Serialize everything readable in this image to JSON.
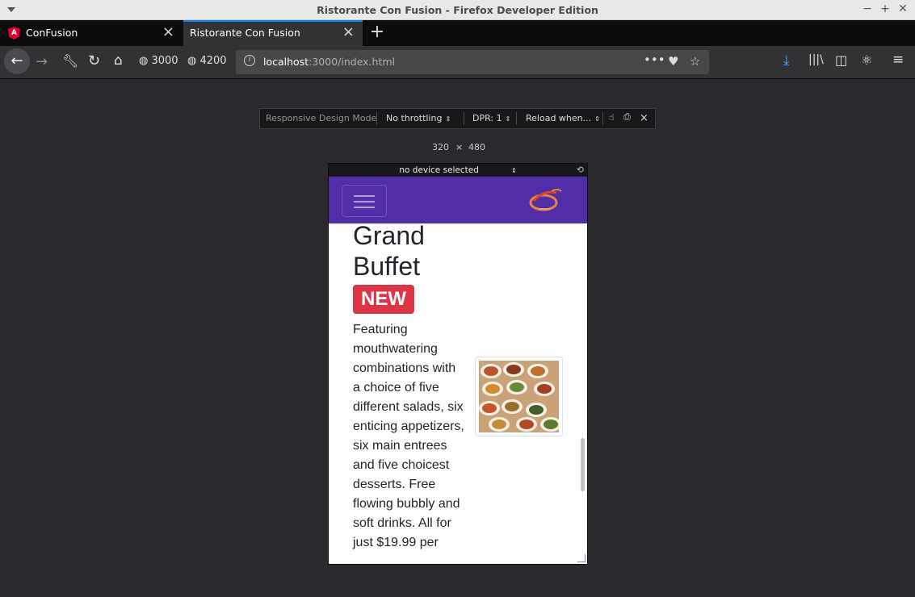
{
  "window": {
    "title": "Ristorante Con Fusion - Firefox Developer Edition",
    "controls": [
      "−",
      "+",
      "✕"
    ]
  },
  "tabs": [
    {
      "label": "ConFusion",
      "icon": "angular-icon",
      "active": false
    },
    {
      "label": "Ristorante Con Fusion",
      "active": true
    }
  ],
  "nav": {
    "bookmarks": [
      {
        "label": "3000",
        "icon": "globe-icon"
      },
      {
        "label": "4200",
        "icon": "globe-icon"
      }
    ],
    "url_host": "localhost",
    "url_path": ":3000/index.html"
  },
  "rdm": {
    "mode_label": "Responsive Design Mode",
    "throttling": "No throttling",
    "dpr": "DPR: 1",
    "reload": "Reload when...",
    "width": "320",
    "times": "×",
    "height": "480",
    "device": "no device selected"
  },
  "page": {
    "dish_title": "Grand Buffet",
    "badge": "NEW",
    "description": "Featuring mouthwatering combinations with a choice of five different salads, six enticing appetizers, six main entrees and five choicest desserts. Free flowing bubbly and soft drinks. All for just $19.99 per",
    "nav_color": "#512da8",
    "badge_color": "#dc3545"
  },
  "colors": {
    "accent": "#0a84ff",
    "chrome_dark": "#0c0c0d",
    "toolbar": "#323234"
  }
}
